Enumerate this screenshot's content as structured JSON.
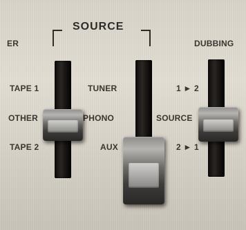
{
  "labels": {
    "edge_left": "ER",
    "source_title": "SOURCE",
    "dubbing_title": "DUBBING",
    "tape1": "TAPE 1",
    "other": "OTHER",
    "tape2": "TAPE 2",
    "tuner": "TUNER",
    "phono": "PHONO",
    "aux": "AUX",
    "dub_1_to_2": "1 ► 2",
    "dub_source": "SOURCE",
    "dub_2_to_1": "2 ► 1"
  }
}
